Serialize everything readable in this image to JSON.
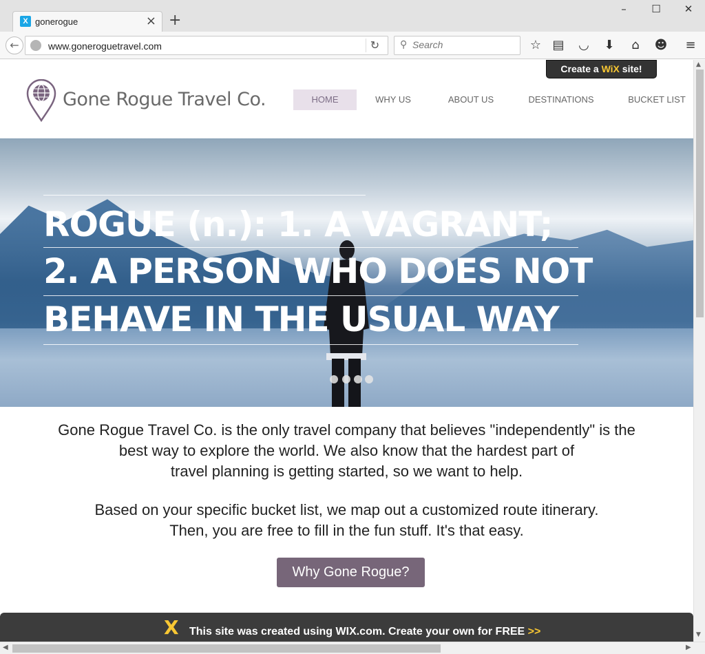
{
  "browser": {
    "tab_title": "gonerogue",
    "tab_favicon": "X",
    "url": "www.goneroguetravel.com",
    "search_placeholder": "Search",
    "window_controls": [
      "minimize-icon",
      "maximize-icon",
      "close-icon"
    ],
    "toolbar_icons": [
      "star-icon",
      "reading-list-icon",
      "pocket-icon",
      "download-icon",
      "home-icon",
      "chat-icon",
      "menu-icon"
    ]
  },
  "site": {
    "title": "Gone Rogue Travel Co.",
    "nav": [
      {
        "label": "HOME",
        "active": true
      },
      {
        "label": "WHY US",
        "active": false
      },
      {
        "label": "ABOUT US",
        "active": false
      },
      {
        "label": "DESTINATIONS",
        "active": false
      },
      {
        "label": "BUCKET LIST",
        "active": false
      }
    ],
    "wix_badge": {
      "prefix": "Create a ",
      "brand": "WiX",
      "suffix": " site!"
    }
  },
  "hero": {
    "lines": [
      "ROGUE (n.): 1. A VAGRANT;",
      "2. A PERSON WHO DOES NOT",
      "BEHAVE IN THE USUAL WAY"
    ],
    "slide_count": 4
  },
  "content": {
    "intro_lines": [
      "Gone Rogue Travel Co. is the only travel company that believes \"independently\" is the",
      "best way to explore the world. We also know that the hardest part of",
      "travel planning is getting started, so we want to help."
    ],
    "detail_lines": [
      "Based on your specific bucket list, we map out a customized route itinerary.",
      "Then, you are free to fill in the fun stuff. It's that easy."
    ],
    "cta_label": "Why Gone Rogue?"
  },
  "wix_footer": {
    "logo": "X",
    "text": "This site was created using WIX.com. Create your own for FREE ",
    "arrows": ">>"
  },
  "colors": {
    "accent": "#776679",
    "nav_active_bg": "#e8e0ea",
    "wix_yellow": "#f8c733"
  }
}
